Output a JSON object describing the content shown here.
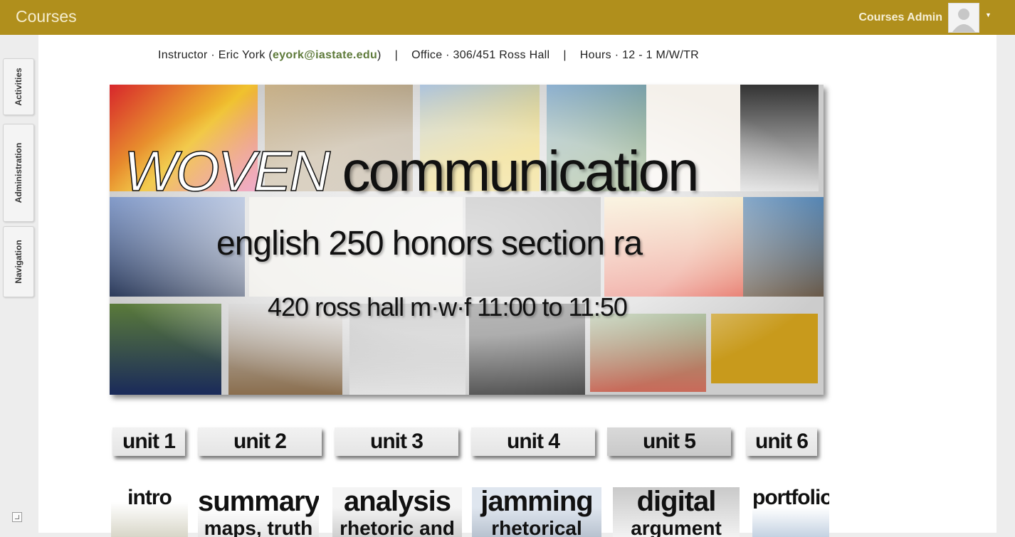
{
  "topbar": {
    "brand": "Courses",
    "user_name": "Courses Admin",
    "bg_color": "#b08f1c"
  },
  "sidebar": {
    "blocks": [
      {
        "label": "Activities"
      },
      {
        "label": "Administration"
      },
      {
        "label": "Navigation"
      }
    ]
  },
  "header_info": {
    "instructor_prefix": "Instructor · Eric York (",
    "email": "eyork@iastate.edu",
    "instructor_suffix": ")",
    "separator": "|",
    "office": "Office · 306/451 Ross Hall",
    "hours": "Hours · 12 - 1 M/W/TR"
  },
  "banner": {
    "title_word1": "WOVEN",
    "title_word2": "communication",
    "subtitle": "english 250 honors  section ra",
    "schedule": "420 ross hall m·w·f 11:00 to 11:50"
  },
  "units": [
    {
      "label": "unit 1",
      "active": false
    },
    {
      "label": "unit 2",
      "active": false
    },
    {
      "label": "unit 3",
      "active": false
    },
    {
      "label": "unit 4",
      "active": false
    },
    {
      "label": "unit 5",
      "active": true
    },
    {
      "label": "unit 6",
      "active": false
    }
  ],
  "topics": [
    {
      "title": "intro",
      "sub": ""
    },
    {
      "title": "summary",
      "sub": "maps, truth"
    },
    {
      "title": "analysis",
      "sub": "rhetoric and"
    },
    {
      "title": "jamming",
      "sub": "rhetorical"
    },
    {
      "title": "digital",
      "sub": "argument"
    },
    {
      "title": "portfolio",
      "sub": ""
    }
  ]
}
